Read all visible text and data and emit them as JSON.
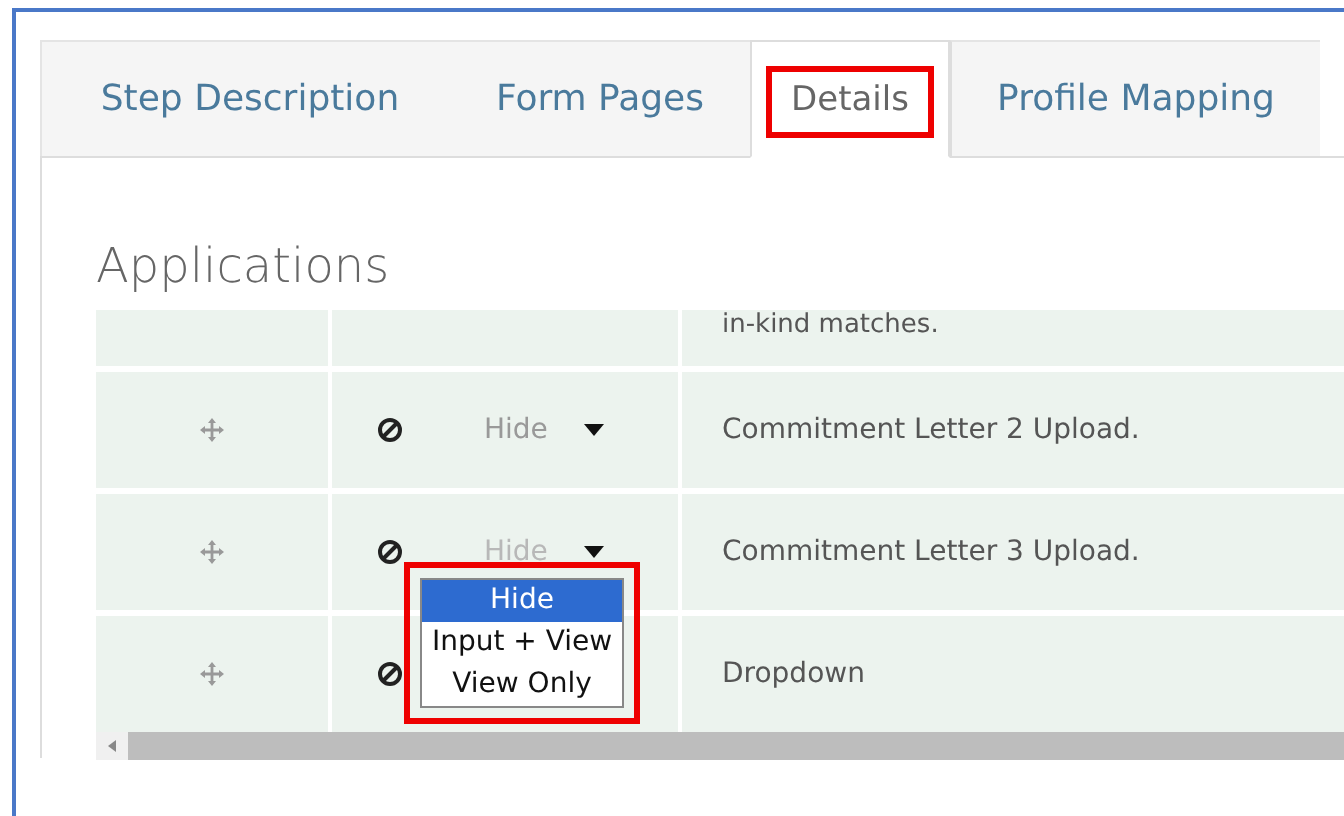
{
  "tabs": [
    {
      "label": "Step Description",
      "selected": false,
      "highlighted": false
    },
    {
      "label": "Form Pages",
      "selected": false,
      "highlighted": false
    },
    {
      "label": "Details",
      "selected": true,
      "highlighted": true
    },
    {
      "label": "Profile Mapping",
      "selected": false,
      "highlighted": false
    }
  ],
  "section_title": "Applications",
  "rows": [
    {
      "description": "in-kind matches.",
      "partial": true,
      "menu_open": false
    },
    {
      "visibility": "Hide",
      "description": "Commitment Letter 2 Upload.",
      "partial": false,
      "menu_open": false
    },
    {
      "visibility": "Hide",
      "description": "Commitment Letter 3 Upload.",
      "partial": false,
      "menu_open": true
    },
    {
      "description": "Dropdown",
      "partial": false,
      "menu_open": false
    }
  ],
  "dropdown": {
    "highlighted": true,
    "options": [
      {
        "label": "Hide",
        "selected": true
      },
      {
        "label": "Input + View",
        "selected": false
      },
      {
        "label": "View Only",
        "selected": false
      }
    ]
  }
}
